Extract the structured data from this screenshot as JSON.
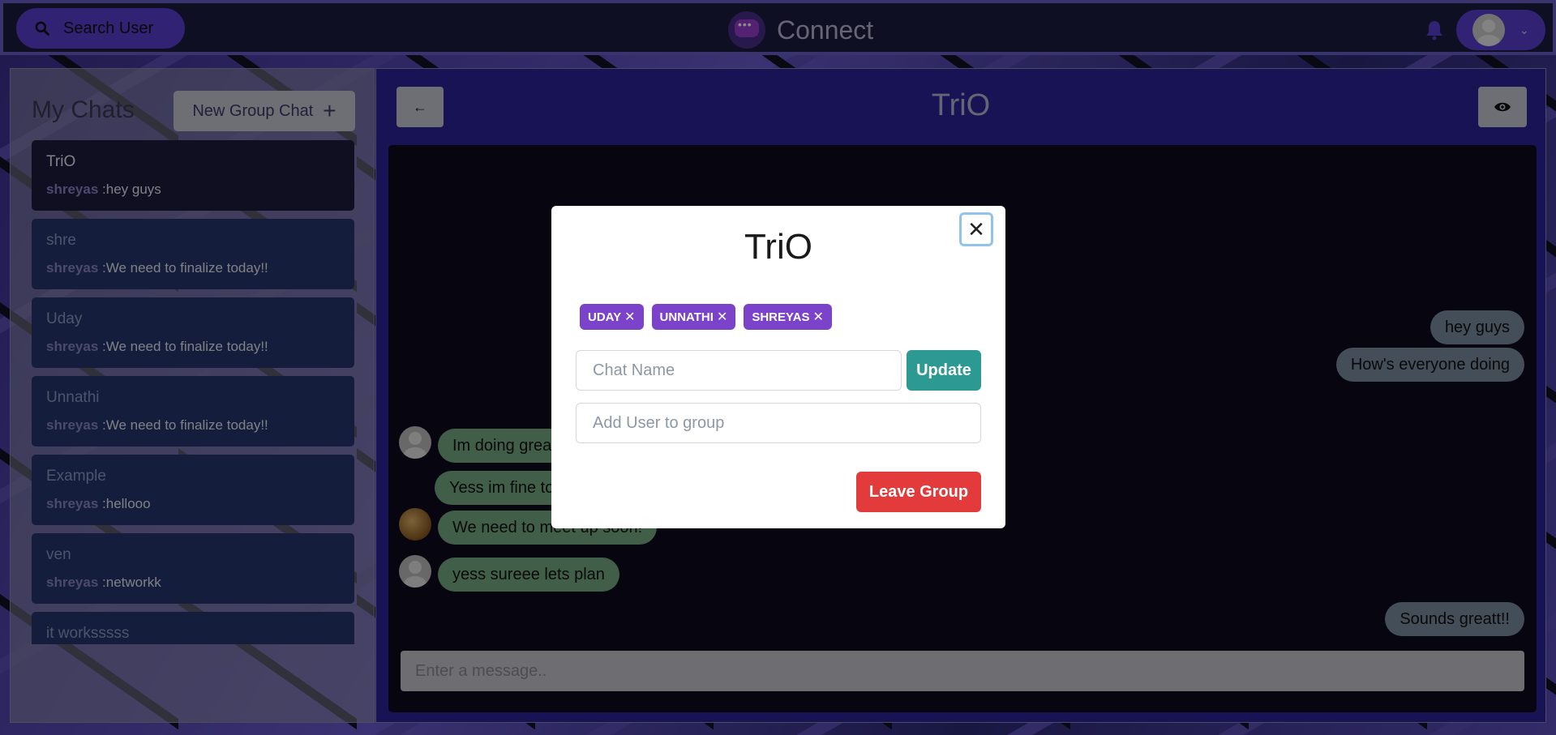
{
  "header": {
    "search_label": "Search User",
    "brand_name": "Connect"
  },
  "sidebar": {
    "title": "My Chats",
    "new_group_label": "New Group Chat",
    "chats": [
      {
        "name": "TriO",
        "sender": "shreyas",
        "last_message": "hey guys",
        "active": true
      },
      {
        "name": "shre",
        "sender": "shreyas",
        "last_message": "We need to finalize today!!"
      },
      {
        "name": "Uday",
        "sender": "shreyas",
        "last_message": "We need to finalize today!!"
      },
      {
        "name": "Unnathi",
        "sender": "shreyas",
        "last_message": "We need to finalize today!!"
      },
      {
        "name": "Example",
        "sender": "shreyas",
        "last_message": "hellooo"
      },
      {
        "name": "ven",
        "sender": "shreyas",
        "last_message": "networkk"
      },
      {
        "name": "it worksssss",
        "sender": "",
        "last_message": ""
      }
    ]
  },
  "chat": {
    "title": "TriO",
    "message_placeholder": "Enter a message..",
    "messages": [
      {
        "text": "hey guys",
        "mine": true
      },
      {
        "text": "How's everyone doing",
        "mine": true
      },
      {
        "text": "Im doing great",
        "mine": false
      },
      {
        "text": "Yess im fine too",
        "mine": false
      },
      {
        "text": "We need to meet up soon!",
        "mine": false
      },
      {
        "text": "yess sureee lets plan",
        "mine": false
      },
      {
        "text": "Sounds greatt!!",
        "mine": true
      }
    ]
  },
  "modal": {
    "title": "TriO",
    "members": [
      "UDAY",
      "UNNATHI",
      "SHREYAS"
    ],
    "chat_name_placeholder": "Chat Name",
    "update_label": "Update",
    "add_user_placeholder": "Add User to group",
    "leave_label": "Leave Group"
  },
  "colors": {
    "accent": "#5a3fd1",
    "badge": "#7b43c9",
    "update": "#2c9a93",
    "leave": "#e33b3b",
    "mine_bubble": "#7b8ea0",
    "theirs_bubble": "#77ad83"
  }
}
